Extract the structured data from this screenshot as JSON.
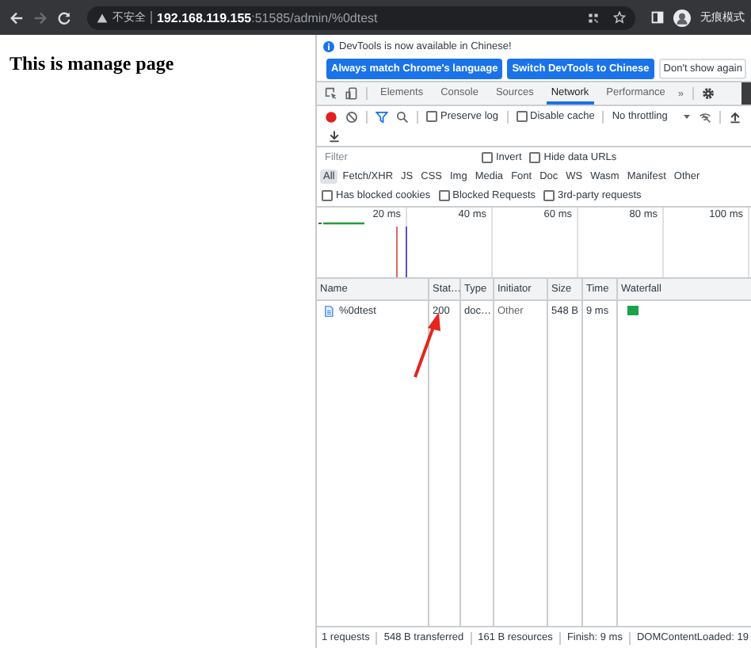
{
  "browser": {
    "security_label": "不安全",
    "url_host": "192.168.119.155",
    "url_path": ":51585/admin/%0dtest",
    "profile_label": "无痕模式"
  },
  "page": {
    "heading": "This is manage page"
  },
  "devtools": {
    "infobar": {
      "message": "DevTools is now available in Chinese!",
      "buttons": [
        {
          "label": "Always match Chrome's language",
          "kind": "primary"
        },
        {
          "label": "Switch DevTools to Chinese",
          "kind": "primary"
        },
        {
          "label": "Don't show again",
          "kind": "plain"
        }
      ]
    },
    "tabs": [
      {
        "label": "Elements",
        "selected": false
      },
      {
        "label": "Console",
        "selected": false
      },
      {
        "label": "Sources",
        "selected": false
      },
      {
        "label": "Network",
        "selected": true
      },
      {
        "label": "Performance",
        "selected": false
      }
    ],
    "more_tabs": "»",
    "toolbar": {
      "recording": true,
      "options": [
        {
          "label": "Preserve log",
          "checked": false
        },
        {
          "label": "Disable cache",
          "checked": false
        }
      ],
      "throttling": "No throttling"
    },
    "filter": {
      "placeholder": "Filter",
      "options": [
        {
          "label": "Invert",
          "checked": false
        },
        {
          "label": "Hide data URLs",
          "checked": false
        }
      ]
    },
    "type_filters": [
      {
        "label": "All",
        "selected": true
      },
      {
        "label": "Fetch/XHR",
        "selected": false
      },
      {
        "label": "JS",
        "selected": false
      },
      {
        "label": "CSS",
        "selected": false
      },
      {
        "label": "Img",
        "selected": false
      },
      {
        "label": "Media",
        "selected": false
      },
      {
        "label": "Font",
        "selected": false
      },
      {
        "label": "Doc",
        "selected": false
      },
      {
        "label": "WS",
        "selected": false
      },
      {
        "label": "Wasm",
        "selected": false
      },
      {
        "label": "Manifest",
        "selected": false
      },
      {
        "label": "Other",
        "selected": false
      }
    ],
    "blocked_filters": [
      {
        "label": "Has blocked cookies",
        "checked": false
      },
      {
        "label": "Blocked Requests",
        "checked": false
      },
      {
        "label": "3rd-party requests",
        "checked": false
      }
    ],
    "overview": {
      "ticks": [
        "20 ms",
        "40 ms",
        "60 ms",
        "80 ms",
        "100 ms"
      ]
    },
    "table": {
      "columns": [
        "Name",
        "Stat…",
        "Type",
        "Initiator",
        "Size",
        "Time",
        "Waterfall"
      ],
      "rows": [
        {
          "name": "%0dtest",
          "status": "200",
          "type": "doc…",
          "initiator": "Other",
          "size": "548 B",
          "time": "9 ms"
        }
      ]
    },
    "status_bar": [
      "1 requests",
      "548 B transferred",
      "161 B resources",
      "Finish: 9 ms",
      "DOMContentLoaded: 19"
    ]
  }
}
